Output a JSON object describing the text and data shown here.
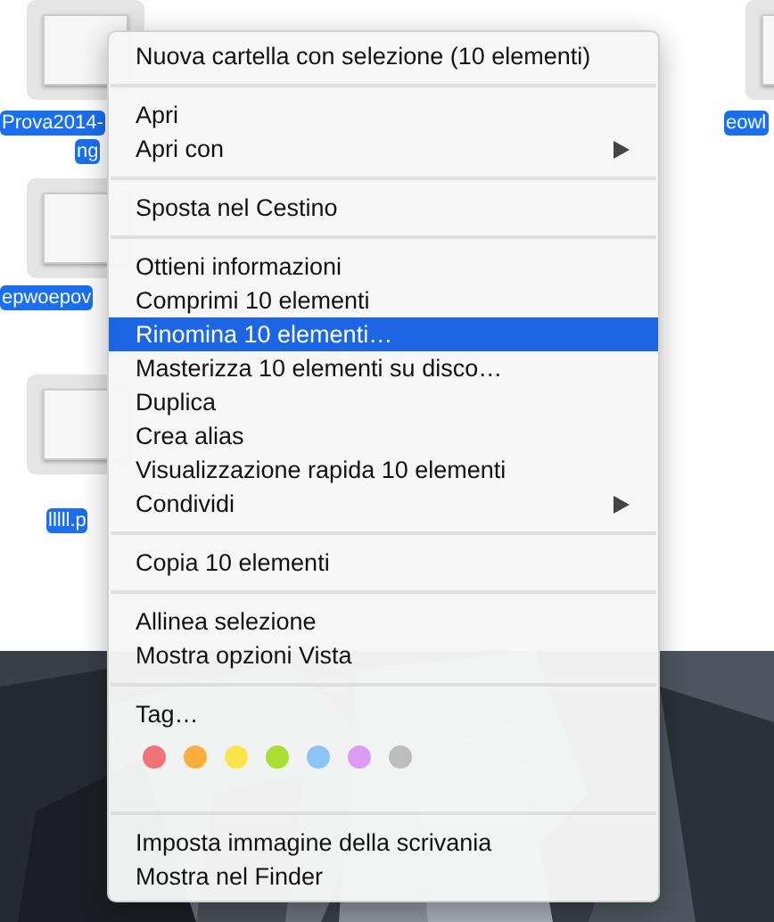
{
  "desktop": {
    "files": [
      {
        "label": "Prova2014-",
        "label_2": "ng"
      },
      {
        "label": "eowl"
      },
      {
        "label": "epwoepov"
      },
      {
        "label": "lllll.p"
      }
    ]
  },
  "context_menu": {
    "sections": [
      {
        "items": [
          {
            "kind": "item",
            "label": "Nuova cartella con selezione (10 elementi)",
            "submenu": false,
            "selected": false
          }
        ]
      },
      {
        "items": [
          {
            "kind": "item",
            "label": "Apri",
            "submenu": false,
            "selected": false
          },
          {
            "kind": "item",
            "label": "Apri con",
            "submenu": true,
            "selected": false
          }
        ]
      },
      {
        "items": [
          {
            "kind": "item",
            "label": "Sposta nel Cestino",
            "submenu": false,
            "selected": false
          }
        ]
      },
      {
        "items": [
          {
            "kind": "item",
            "label": "Ottieni informazioni",
            "submenu": false,
            "selected": false
          },
          {
            "kind": "item",
            "label": "Comprimi 10 elementi",
            "submenu": false,
            "selected": false
          },
          {
            "kind": "item",
            "label": "Rinomina 10 elementi…",
            "submenu": false,
            "selected": true
          },
          {
            "kind": "item",
            "label": "Masterizza 10 elementi su disco…",
            "submenu": false,
            "selected": false
          },
          {
            "kind": "item",
            "label": "Duplica",
            "submenu": false,
            "selected": false
          },
          {
            "kind": "item",
            "label": "Crea alias",
            "submenu": false,
            "selected": false
          },
          {
            "kind": "item",
            "label": "Visualizzazione rapida 10 elementi",
            "submenu": false,
            "selected": false
          },
          {
            "kind": "item",
            "label": "Condividi",
            "submenu": true,
            "selected": false
          }
        ]
      },
      {
        "items": [
          {
            "kind": "item",
            "label": "Copia 10 elementi",
            "submenu": false,
            "selected": false
          }
        ]
      },
      {
        "items": [
          {
            "kind": "item",
            "label": "Allinea selezione",
            "submenu": false,
            "selected": false
          },
          {
            "kind": "item",
            "label": "Mostra opzioni Vista",
            "submenu": false,
            "selected": false
          }
        ]
      },
      {
        "items": [
          {
            "kind": "item",
            "label": "Tag…",
            "submenu": false,
            "selected": false
          },
          {
            "kind": "tags",
            "colors": [
              {
                "color": "#f2727a"
              },
              {
                "color": "#fbae3c"
              },
              {
                "color": "#f8e54a"
              },
              {
                "color": "#a9de32"
              },
              {
                "color": "#8cc4f6"
              },
              {
                "color": "#dd9cf3"
              },
              {
                "color": "#bdbdbd"
              }
            ]
          }
        ]
      },
      {
        "items": [
          {
            "kind": "item",
            "label": "Imposta immagine della scrivania",
            "submenu": false,
            "selected": false
          },
          {
            "kind": "item",
            "label": "Mostra nel Finder",
            "submenu": false,
            "selected": false
          }
        ]
      }
    ]
  }
}
